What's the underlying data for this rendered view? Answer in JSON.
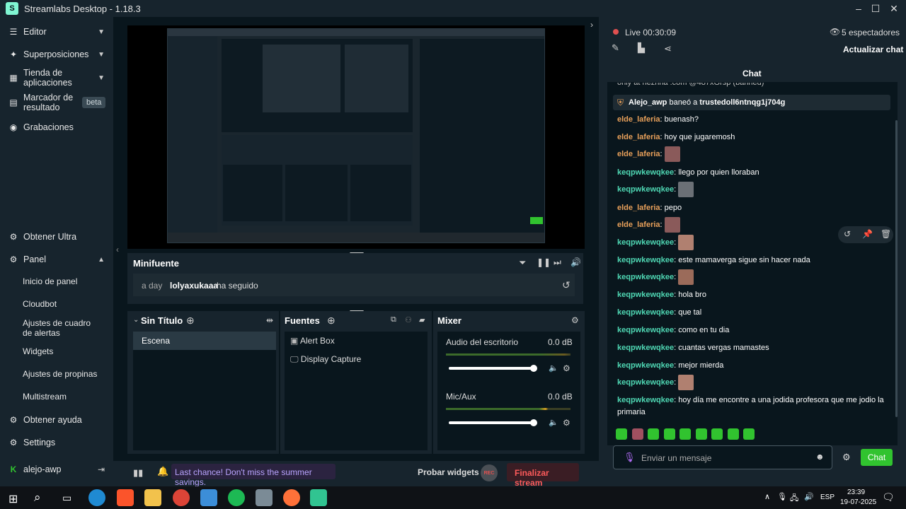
{
  "app": {
    "title": "Streamlabs Desktop - 1.18.3"
  },
  "sidebar": {
    "top": [
      {
        "label": "Editor"
      },
      {
        "label": "Superposiciones"
      },
      {
        "label": "Tienda de aplicaciones"
      },
      {
        "label": "Marcador de resultado",
        "badge": "beta"
      },
      {
        "label": "Grabaciones"
      }
    ],
    "ultra": "Obtener Ultra",
    "panel": "Panel",
    "panel_items": [
      "Inicio de panel",
      "Cloudbot",
      "Ajustes de cuadro de alertas",
      "Widgets",
      "Ajustes de propinas",
      "Multistream"
    ],
    "help": "Obtener ayuda",
    "settings": "Settings",
    "user": "alejo-awp"
  },
  "minifuente": {
    "title": "Minifuente",
    "time": "a day",
    "user": "lolyaxukaaa",
    "action": "ha seguido"
  },
  "scenes": {
    "title": "Sin Título",
    "items": [
      "Escena"
    ]
  },
  "sources": {
    "title": "Fuentes",
    "items": [
      "Alert Box",
      "Display Capture"
    ]
  },
  "mixer": {
    "title": "Mixer",
    "channels": [
      {
        "name": "Audio del escritorio",
        "db": "0.0 dB",
        "level": 0.95
      },
      {
        "name": "Mic/Aux",
        "db": "0.0 dB",
        "level": 0.95
      }
    ]
  },
  "footer": {
    "promo": "Last chance! Don't miss the summer savings.",
    "test_widgets": "Probar widgets",
    "rec": "REC",
    "end_stream": "Finalizar stream"
  },
  "stream": {
    "live": "Live 00:30:09",
    "viewers": "5 espectadores",
    "refresh_chat": "Actualizar chat"
  },
  "chat": {
    "title": "Chat",
    "cut_line": "only at nezhna .com @487xGrsp (banned)",
    "ban_notice": {
      "user": "Alejo_awp",
      "action": "baneó a",
      "target": "trustedoll6ntnqg1j704g"
    },
    "messages": [
      {
        "user": "elde_laferia",
        "text": ": buenash?"
      },
      {
        "user": "elde_laferia",
        "text": ": hoy que jugaremosh"
      },
      {
        "user": "elde_laferia",
        "text": ":",
        "emote": true
      },
      {
        "user": "keqpwkewqkee",
        "text": ": llego por quien lloraban"
      },
      {
        "user": "keqpwkewqkee",
        "text": ":",
        "emote": true
      },
      {
        "user": "elde_laferia",
        "text": ": pepo"
      },
      {
        "user": "elde_laferia",
        "text": ":",
        "emote": true
      },
      {
        "user": "keqpwkewqkee",
        "text": ":",
        "emote": true
      },
      {
        "user": "keqpwkewqkee",
        "text": ": este mamaverga sigue sin hacer nada"
      },
      {
        "user": "keqpwkewqkee",
        "text": ":",
        "emote": true
      },
      {
        "user": "keqpwkewqkee",
        "text": ": hola bro"
      },
      {
        "user": "keqpwkewqkee",
        "text": ": que tal"
      },
      {
        "user": "keqpwkewqkee",
        "text": ": como en tu dia"
      },
      {
        "user": "keqpwkewqkee",
        "text": ": cuantas vergas mamastes"
      },
      {
        "user": "keqpwkewqkee",
        "text": ": mejor mierda"
      },
      {
        "user": "keqpwkewqkee",
        "text": ":",
        "emote": true
      },
      {
        "user": "keqpwkewqkee",
        "text": ": hoy día me encontre a una jodida profesora que me jodio la"
      }
    ],
    "last_line_wrap": "primaria",
    "input_placeholder": "Enviar un mensaje",
    "send": "Chat"
  },
  "colors": {
    "accent": "#80f5d2",
    "orange_user": "#e8a05a",
    "teal_user": "#4fd8b4",
    "live_dot": "#e05050",
    "chat_btn": "#31c32f"
  },
  "taskbar": {
    "lang": "ESP",
    "time": "23:39",
    "date": "19-07-2025"
  }
}
